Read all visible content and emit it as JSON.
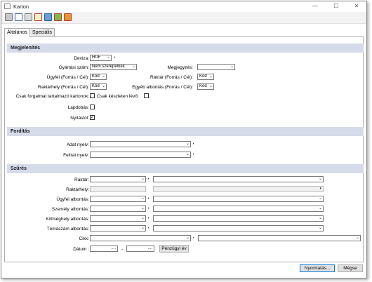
{
  "window": {
    "title": "Karton",
    "minimize": "—",
    "maximize": "☐",
    "close": "✕"
  },
  "toolbar": {
    "icons": [
      "printer-icon",
      "preview-icon",
      "export-icon",
      "edit-icon",
      "table-icon",
      "chart-icon",
      "close-doc-icon"
    ]
  },
  "tabs": [
    {
      "label": "Általános",
      "active": true
    },
    {
      "label": "Speciális",
      "active": false
    }
  ],
  "sections": {
    "display": "Megjelenítés",
    "translation": "Fordítás",
    "filter": "Szűrés"
  },
  "display": {
    "currency_label": "Deviza:",
    "currency_value": "HUF",
    "serial_label": "Gyártási szám:",
    "serial_value": "Nem szerepelnek",
    "note_label": "Megjegyzés:",
    "note_value": "",
    "customer_label": "Ügyfél (Forrás / Cél):",
    "customer_value": "Kód",
    "warehouse_label": "Raktár (Forrás / Cél):",
    "warehouse_value": "Kód",
    "location_label": "Raktárhely (Forrás / Cél):",
    "location_value": "Kód",
    "other_label": "Egyéb albontás (Forrás / Cél):",
    "other_value": "Kód",
    "only_traffic_label": "Csak forgalmat tartalmazó kartonok:",
    "only_stock_label": "Csak készleten lévő:",
    "page_break_label": "Lapdobás:",
    "opening_label": "Nyitástól:"
  },
  "translation": {
    "data_lang_label": "Adat nyelv:",
    "caption_lang_label": "Felirat nyelv:"
  },
  "filter": {
    "warehouse_label": "Raktár:",
    "location_label": "Raktárhely:",
    "customer_sub_label": "Ügyfél albontás:",
    "person_sub_label": "Személy albontás:",
    "cost_sub_label": "Költséghely albontás:",
    "topic_sub_label": "Témaszám albontás:",
    "item_label": "Cikk:",
    "date_label": "Dátum :",
    "date_from": "....",
    "date_sep": "-",
    "date_to": "....",
    "fiscal_year_button": "Pénzügyi év"
  },
  "footer": {
    "print_button": "Nyomtatás...",
    "cancel_button": "Mégse"
  }
}
